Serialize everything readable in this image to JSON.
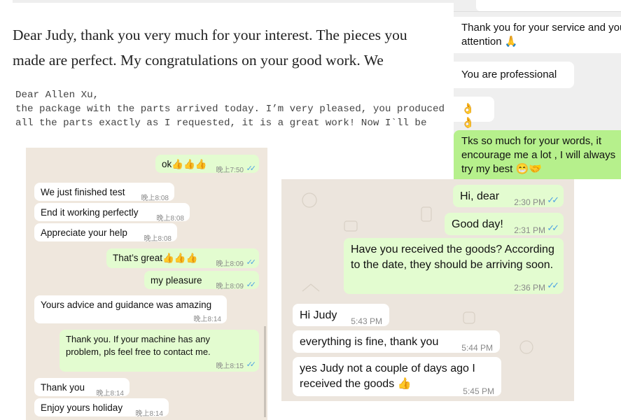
{
  "email": {
    "line1": "Dear Judy, thank you very much for your interest. The pieces you",
    "line2": "made are perfect. My congratulations on your good work. We",
    "mono1": "Dear Allen Xu,",
    "mono2": "the package with the parts arrived today. I’m very pleased, you produced",
    "mono3": "all the parts exactly as I requested, it is a great work! Now I`ll be"
  },
  "chat_left": {
    "messages": [
      {
        "dir": "out",
        "text": "ok👍👍👍",
        "time": "晚上7:50",
        "read": true
      },
      {
        "dir": "in",
        "text": "We just finished test",
        "time": "晚上8:08"
      },
      {
        "dir": "in",
        "text": "End it working perfectly",
        "time": "晚上8:08"
      },
      {
        "dir": "in",
        "text": "Appreciate your help",
        "time": "晚上8:08"
      },
      {
        "dir": "out",
        "text": "That’s great👍👍👍",
        "time": "晚上8:09",
        "read": true
      },
      {
        "dir": "out",
        "text": "my pleasure",
        "time": "晚上8:09",
        "read": true
      },
      {
        "dir": "in",
        "text": "Yours advice and guidance was amazing",
        "time": "晚上8:14"
      },
      {
        "dir": "out",
        "text": "Thank you. If your machine has any problem, pls feel free to contact me.",
        "time": "晚上8:15",
        "read": true
      },
      {
        "dir": "in",
        "text": "Thank you",
        "time": "晚上8:14"
      },
      {
        "dir": "in",
        "text": "Enjoy yours holiday",
        "time": "晚上8:14"
      }
    ]
  },
  "chat_middle": {
    "messages": [
      {
        "dir": "out",
        "text": "Hi, dear",
        "time": "2:30 PM",
        "read": true
      },
      {
        "dir": "out",
        "text": "Good day!",
        "time": "2:31 PM",
        "read": true
      },
      {
        "dir": "out",
        "text": "Have you received the goods? According to the date, they should be arriving soon.",
        "time": "2:36 PM",
        "read": true
      },
      {
        "dir": "in",
        "text": "Hi Judy",
        "time": "5:43 PM"
      },
      {
        "dir": "in",
        "text": "everything is fine, thank you",
        "time": "5:44 PM"
      },
      {
        "dir": "in",
        "text": "yes Judy not a couple of days ago I received the goods 👍",
        "time": "5:45 PM"
      }
    ]
  },
  "chat_right": {
    "messages": [
      {
        "dir": "in",
        "text": "Thank you for your service and you attention 🙏"
      },
      {
        "dir": "in",
        "text": "You are professional"
      },
      {
        "dir": "in",
        "text": "👌👌"
      },
      {
        "dir": "out",
        "text": "Tks so much for your words, it encourage me a lot , I will always try my best 😁🤝"
      }
    ]
  },
  "colors": {
    "incoming": "#ffffff",
    "outgoing": "#e3fcd0",
    "read_ticks": "#4fa3e3",
    "outgoing_right": "#b6f08c"
  }
}
